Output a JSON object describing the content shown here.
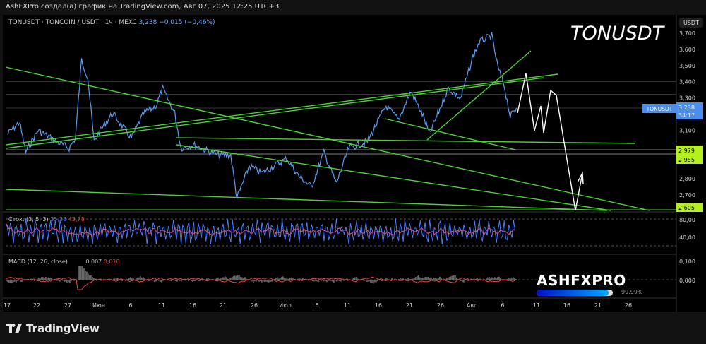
{
  "credit": "AshFXPro создал(а) график на TradingView.com, Авг 07, 2025 12:25 UTC+3",
  "legend": {
    "symbol": "TONUSDT · TONCOIN / USDT · 1ч · MEXC",
    "price": "3,238",
    "change": "−0,015 (−0,46%)"
  },
  "title_overlay": "TONUSDT",
  "stoch": {
    "label": "Стох. (3, 5, 3)",
    "k": "35,38",
    "d": "43,78",
    "axis": [
      "80,00",
      "40,00"
    ]
  },
  "macd": {
    "label": "MACD (12, 26, close)",
    "macd": "0,007",
    "signal": "0,010",
    "axis": [
      "0,100",
      "0,000"
    ]
  },
  "branding": {
    "name": "ASHFXPRO",
    "progress_percent": 99.99,
    "progress_label": "99.99%"
  },
  "footer_logo": "TradingView",
  "colors": {
    "price_line": "#5b9cf0",
    "trendline": "#4cd137",
    "highlight": "#b5f01e",
    "stoch_k": "#4a7bff",
    "stoch_d": "#f04578",
    "macd_signal": "#f04545"
  },
  "chart_data": {
    "type": "line",
    "symbol": "TONUSDT",
    "ylabel": "USDT",
    "ylim": [
      2600,
      3720
    ],
    "y_ticks": [
      "3,700",
      "3,600",
      "3,500",
      "3,400",
      "3,300",
      "3,100",
      "2,800",
      "2,700"
    ],
    "x_ticks": [
      "17",
      "22",
      "27",
      "Июн",
      "6",
      "11",
      "16",
      "21",
      "26",
      "Июл",
      "6",
      "11",
      "16",
      "21",
      "26",
      "Авг",
      "6",
      "11",
      "16",
      "21",
      "26"
    ],
    "price_label": {
      "name": "TONUSDT",
      "value": "3,238",
      "countdown": "34:17"
    },
    "level_labels": [
      "2,979",
      "2,955",
      "2,605"
    ],
    "series": [
      {
        "x": [
          "2025-05-17",
          "2025-05-19",
          "2025-05-20",
          "2025-05-22",
          "2025-05-25",
          "2025-05-27",
          "2025-05-28",
          "2025-05-29",
          "2025-05-30",
          "2025-05-31",
          "2025-06-01",
          "2025-06-03",
          "2025-06-06",
          "2025-06-08",
          "2025-06-10",
          "2025-06-11",
          "2025-06-13",
          "2025-06-14",
          "2025-06-16",
          "2025-06-20",
          "2025-06-22",
          "2025-06-23",
          "2025-06-25",
          "2025-06-27",
          "2025-07-01",
          "2025-07-03",
          "2025-07-05",
          "2025-07-07",
          "2025-07-09",
          "2025-07-11",
          "2025-07-14",
          "2025-07-17",
          "2025-07-19",
          "2025-07-21",
          "2025-07-23",
          "2025-07-24",
          "2025-07-27",
          "2025-07-29",
          "2025-07-31",
          "2025-08-01",
          "2025-08-03",
          "2025-08-04",
          "2025-08-05",
          "2025-08-06",
          "2025-08-07"
        ],
        "y": [
          3075,
          3150,
          2965,
          3100,
          3030,
          2990,
          3050,
          3535,
          3425,
          3030,
          3100,
          3205,
          3050,
          3205,
          3250,
          3360,
          3205,
          2990,
          3010,
          2945,
          2945,
          2680,
          2880,
          2835,
          2925,
          2815,
          2750,
          2965,
          2770,
          2990,
          3030,
          3250,
          3165,
          3340,
          3185,
          3075,
          3360,
          3295,
          3555,
          3645,
          3685,
          3490,
          3380,
          3185,
          3238
        ]
      }
    ]
  }
}
